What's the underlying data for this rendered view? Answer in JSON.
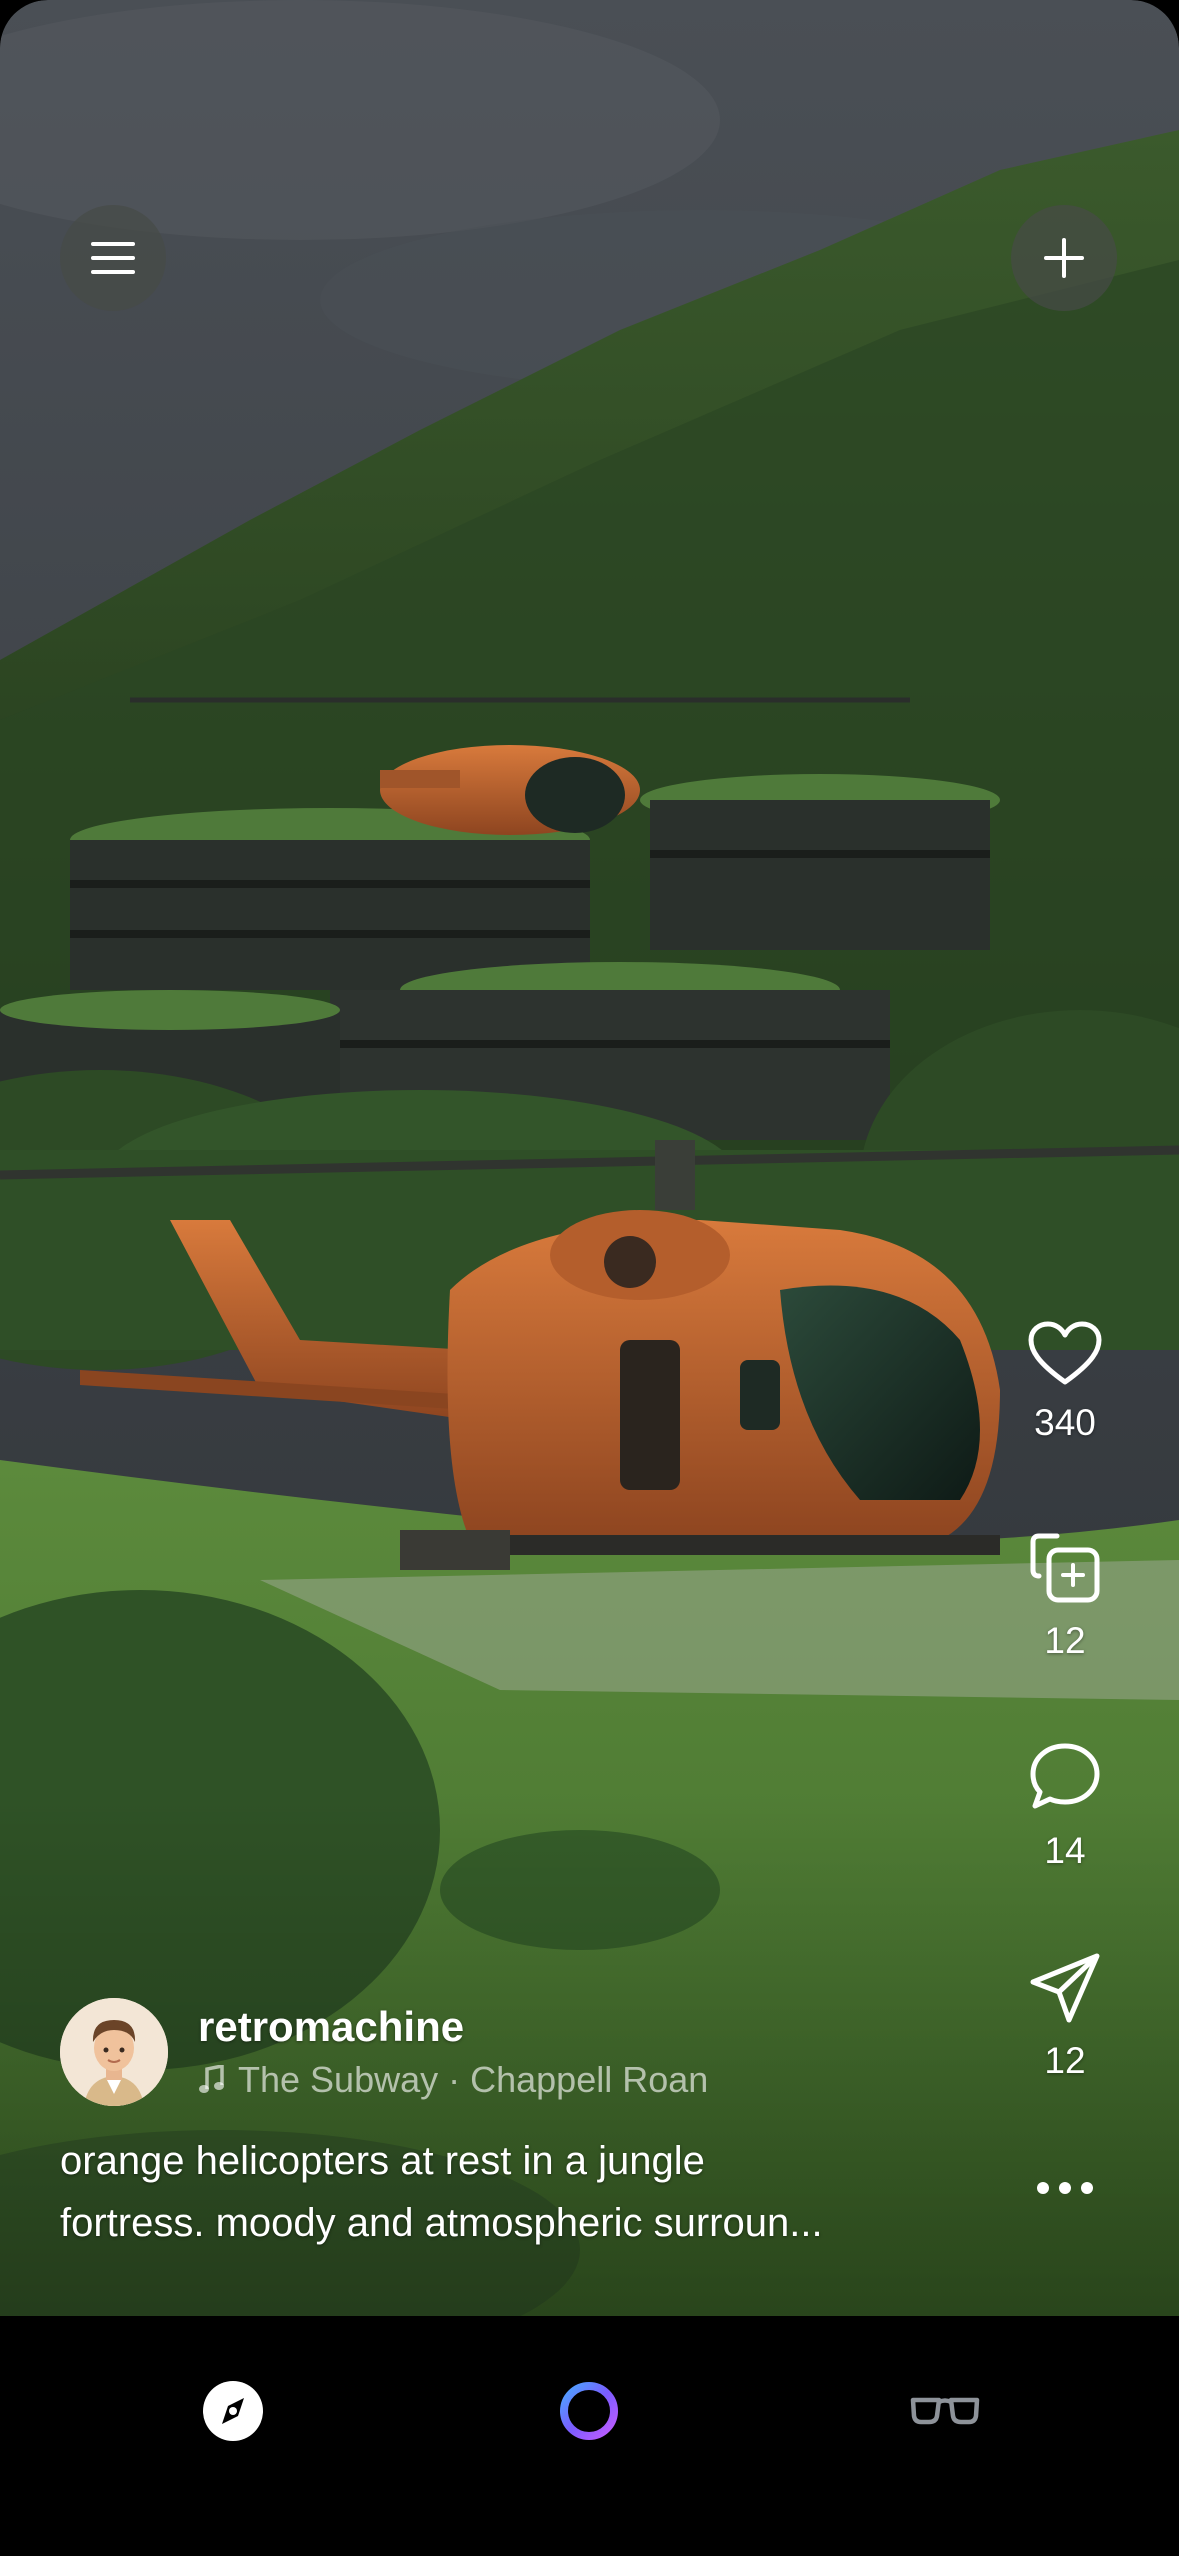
{
  "post": {
    "username": "retromachine",
    "music": {
      "song": "The Subway",
      "separator": "·",
      "artist": "Chappell Roan"
    },
    "caption_line1": "orange helicopters at rest in a jungle",
    "caption_line2": "fortress. moody and atmospheric surroun...",
    "likes": "340",
    "remixes": "12",
    "comments": "14",
    "shares": "12"
  },
  "icons": {
    "menu": "hamburger-icon",
    "add": "plus-icon",
    "like": "heart-icon",
    "remix": "remix-icon",
    "comment": "comment-bubble-icon",
    "share": "paper-plane-icon",
    "more": "more-dots-icon",
    "music": "music-note-icon",
    "tab_explore": "compass-icon",
    "tab_create": "ring-icon",
    "tab_view": "glasses-icon"
  },
  "colors": {
    "sky": "#3d4147",
    "forest": "#2f4a26",
    "grass": "#4f7a35",
    "helicopter": "#c0652e",
    "tabbar": "#000000"
  }
}
